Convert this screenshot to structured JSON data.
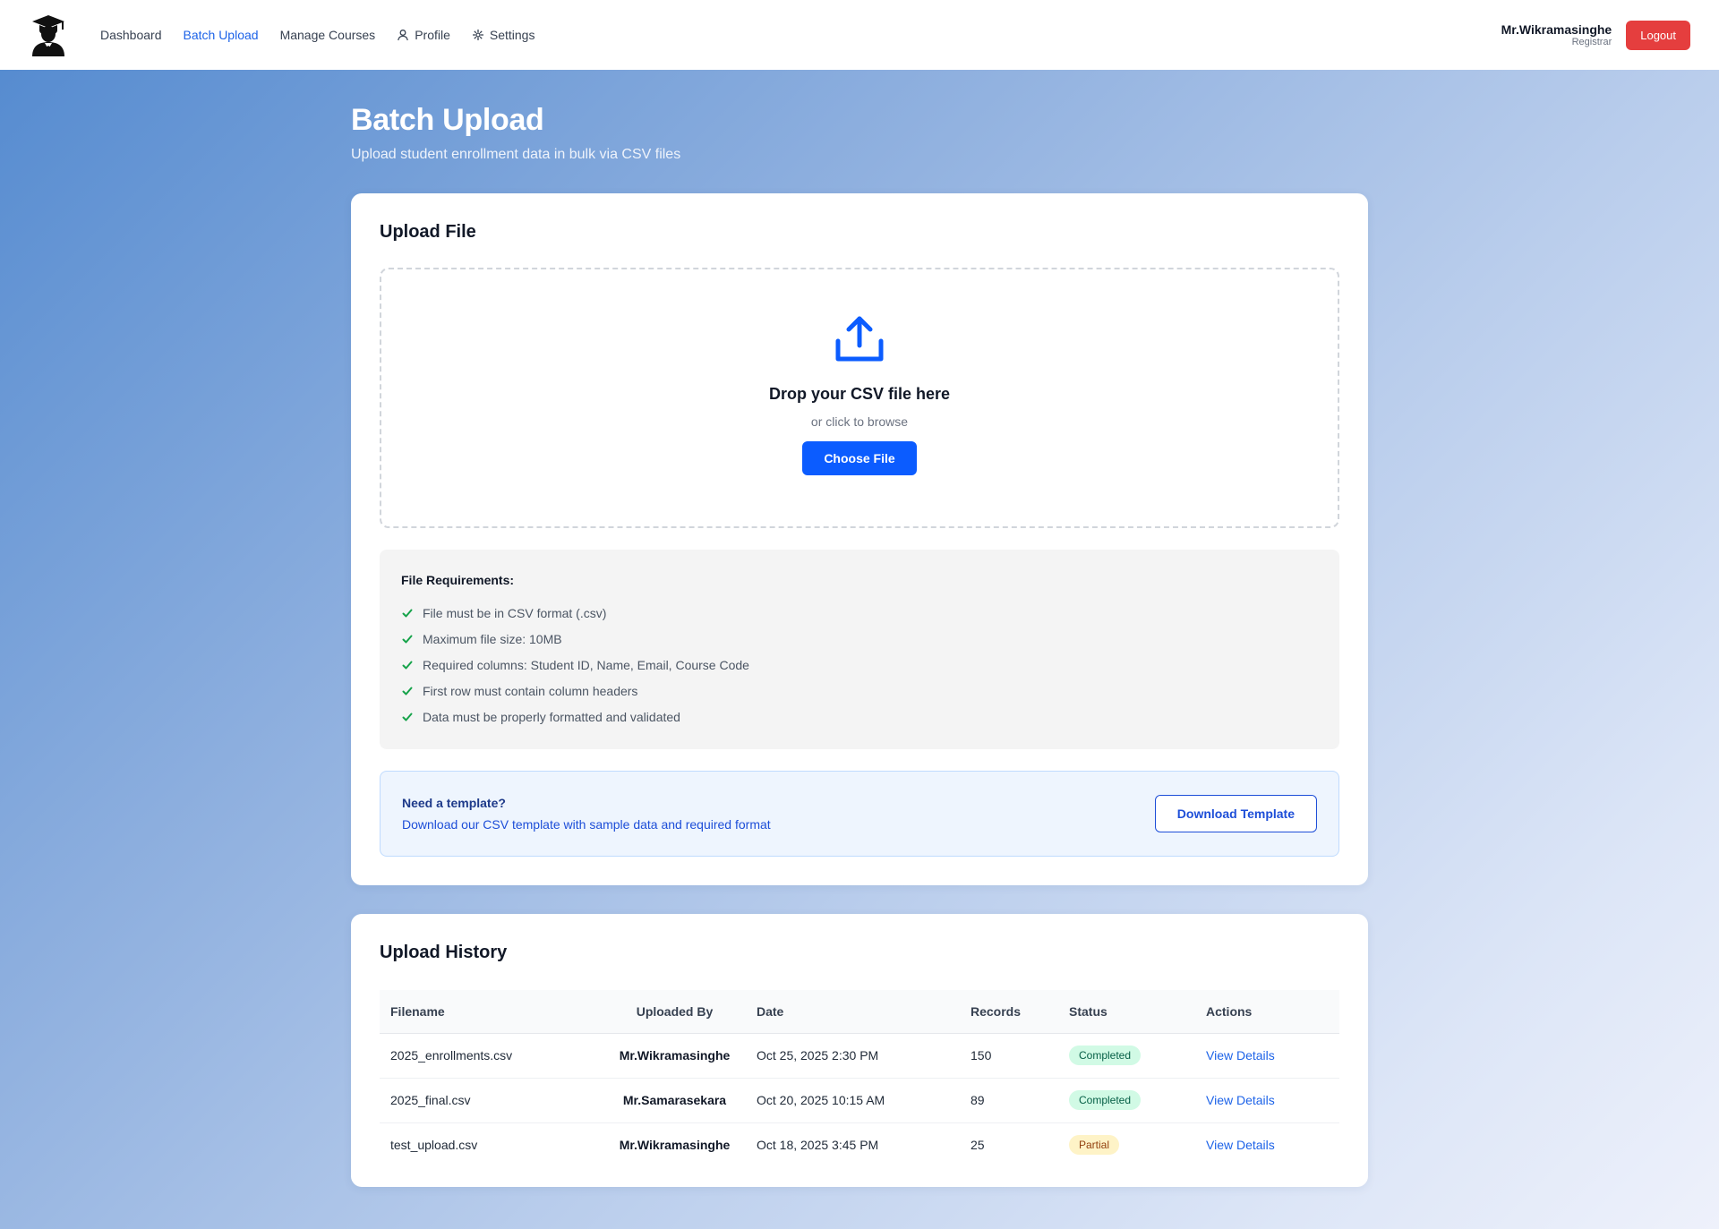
{
  "nav": {
    "items": [
      {
        "label": "Dashboard",
        "icon": ""
      },
      {
        "label": "Batch Upload",
        "icon": ""
      },
      {
        "label": "Manage Courses",
        "icon": ""
      },
      {
        "label": "Profile",
        "icon": "user-icon"
      },
      {
        "label": "Settings",
        "icon": "gear-icon"
      }
    ],
    "active": "Batch Upload"
  },
  "user": {
    "name": "Mr.Wikramasinghe",
    "role": "Registrar",
    "logout_label": "Logout"
  },
  "page": {
    "title": "Batch Upload",
    "subtitle": "Upload student enrollment data in bulk via CSV files"
  },
  "upload": {
    "title": "Upload File",
    "drop_title": "Drop your CSV file here",
    "drop_sub": "or click to browse",
    "choose_label": "Choose File"
  },
  "requirements": {
    "title": "File Requirements:",
    "items": [
      "File must be in CSV format (.csv)",
      "Maximum file size: 10MB",
      "Required columns: Student ID, Name, Email, Course Code",
      "First row must contain column headers",
      "Data must be properly formatted and validated"
    ]
  },
  "template": {
    "title": "Need a template?",
    "description": "Download our CSV template with sample data and required format",
    "button_label": "Download Template"
  },
  "history": {
    "title": "Upload History",
    "columns": [
      "Filename",
      "Uploaded By",
      "Date",
      "Records",
      "Status",
      "Actions"
    ],
    "rows": [
      {
        "filename": "2025_enrollments.csv",
        "uploaded_by": "Mr.Wikramasinghe",
        "date": "Oct 25, 2025 2:30 PM",
        "records": "150",
        "status": "Completed",
        "action": "View Details"
      },
      {
        "filename": "2025_final.csv",
        "uploaded_by": "Mr.Samarasekara",
        "date": "Oct 20, 2025 10:15 AM",
        "records": "89",
        "status": "Completed",
        "action": "View Details"
      },
      {
        "filename": "test_upload.csv",
        "uploaded_by": "Mr.Wikramasinghe",
        "date": "Oct 18, 2025 3:45 PM",
        "records": "25",
        "status": "Partial",
        "action": "View Details"
      }
    ]
  },
  "colors": {
    "accent": "#0b5cff",
    "logout": "#e53e3e",
    "completed": "#065f46",
    "partial": "#92400e"
  }
}
